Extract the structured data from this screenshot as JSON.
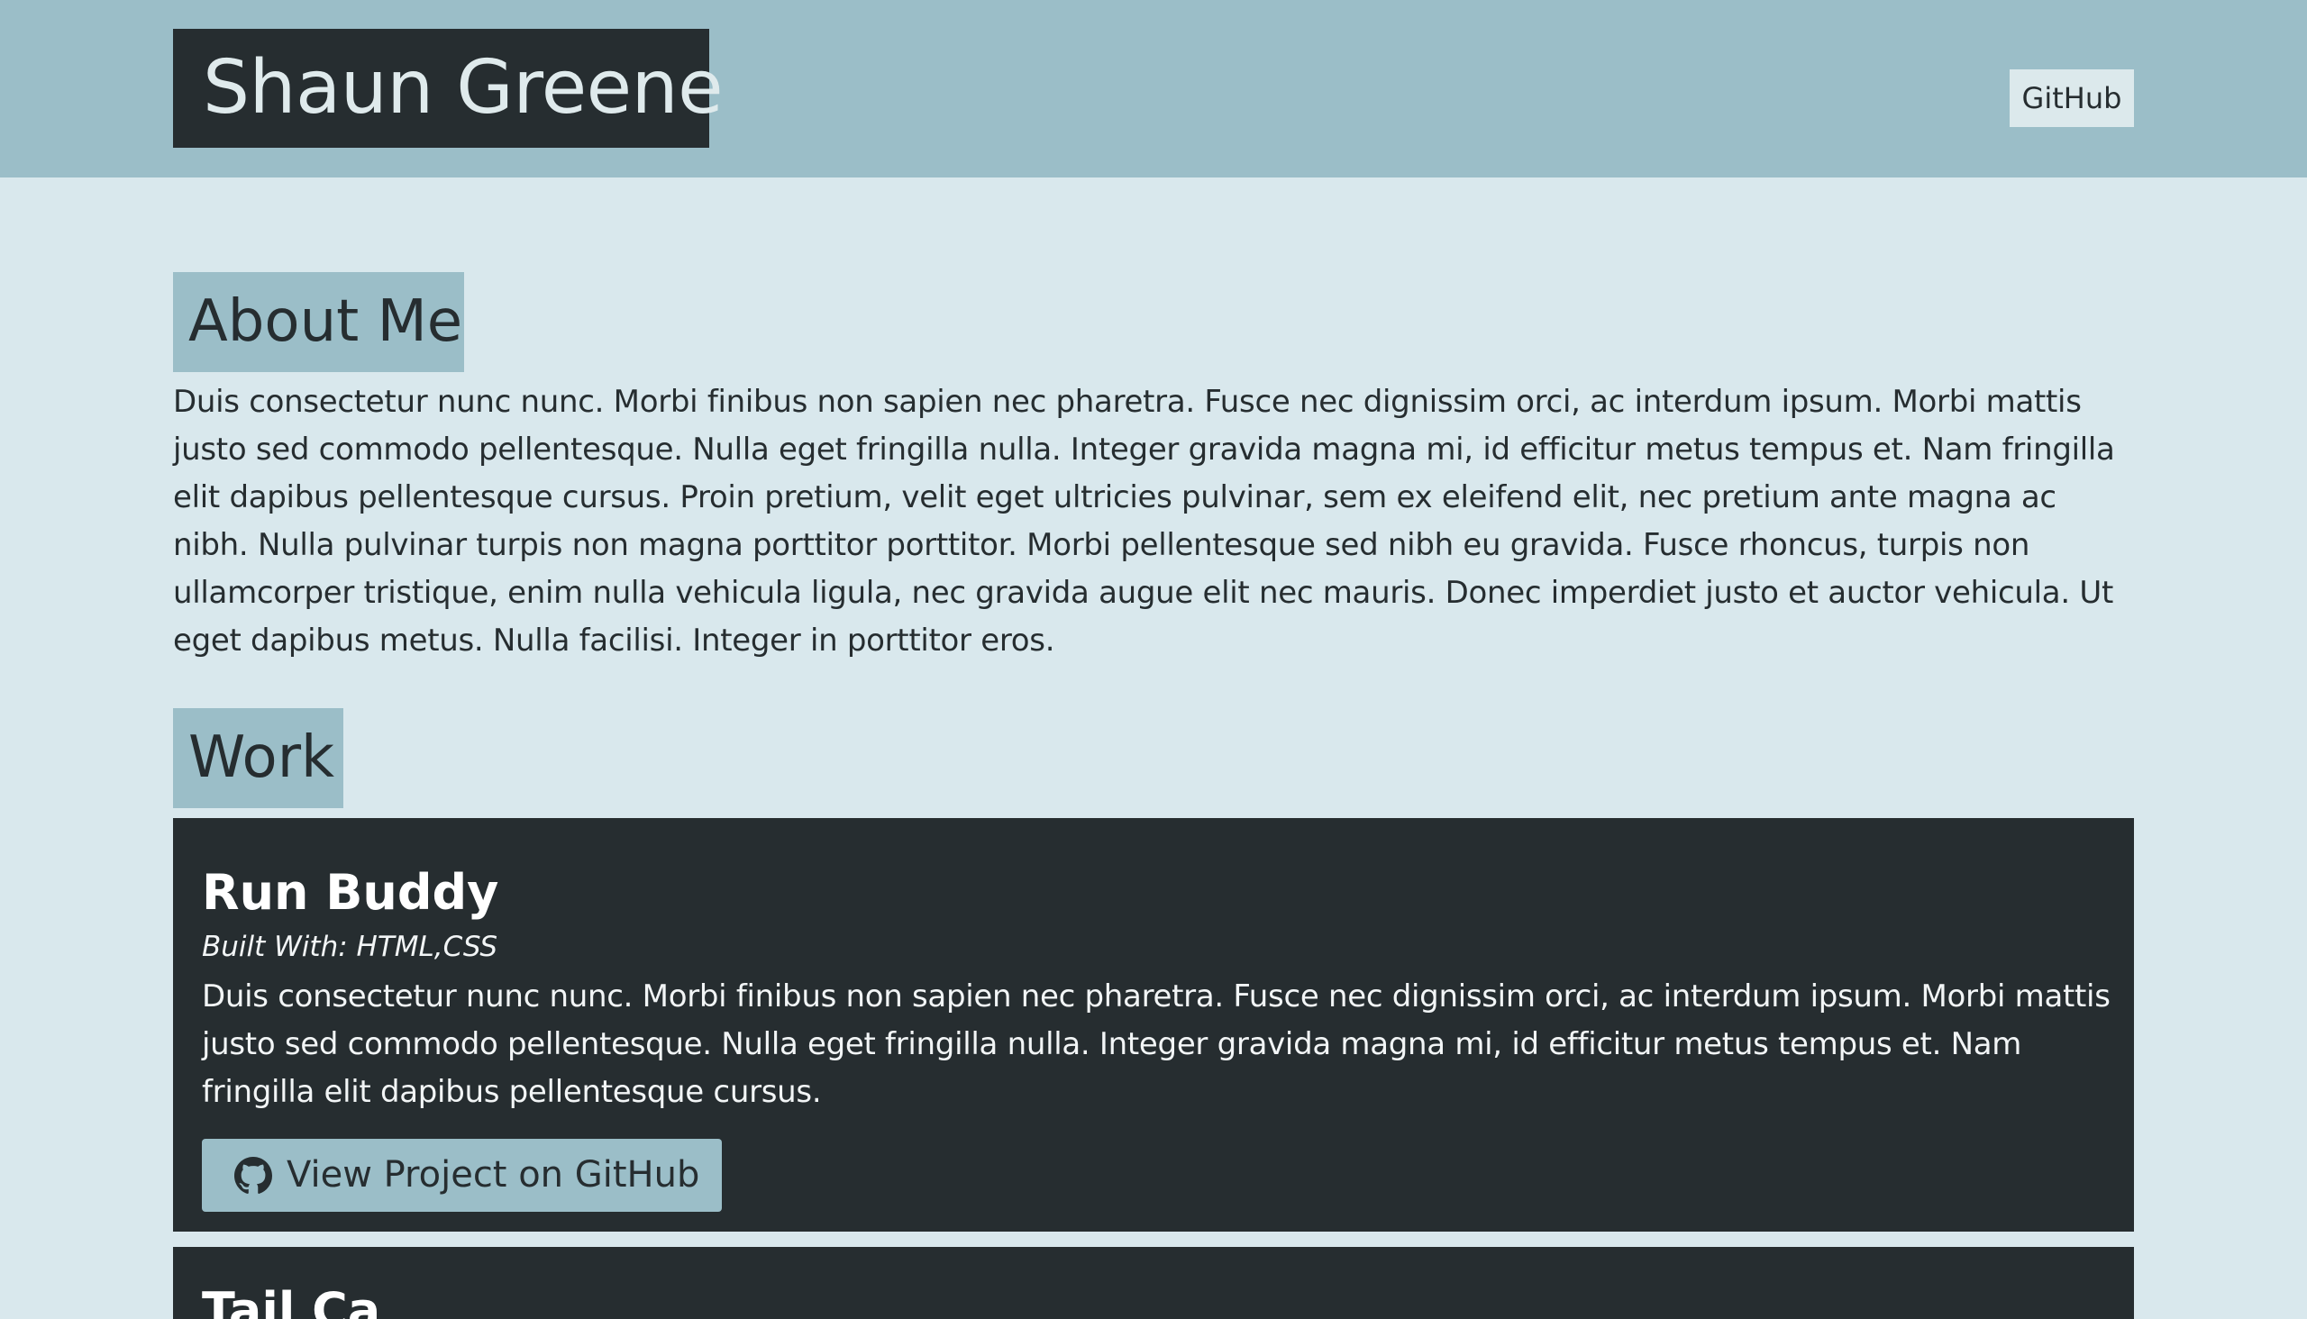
{
  "header": {
    "brand": "Shaun Greene",
    "nav_link": "GitHub"
  },
  "about": {
    "heading": "About Me",
    "text": "Duis consectetur nunc nunc. Morbi finibus non sapien nec pharetra. Fusce nec dignissim orci, ac interdum ipsum. Morbi mattis justo sed commodo pellentesque. Nulla eget fringilla nulla. Integer gravida magna mi, id efficitur metus tempus et. Nam fringilla elit dapibus pellentesque cursus. Proin pretium, velit eget ultricies pulvinar, sem ex eleifend elit, nec pretium ante magna ac nibh. Nulla pulvinar turpis non magna porttitor porttitor. Morbi pellentesque sed nibh eu gravida. Fusce rhoncus, turpis non ullamcorper tristique, enim nulla vehicula ligula, nec gravida augue elit nec mauris. Donec imperdiet justo et auctor vehicula. Ut eget dapibus metus. Nulla facilisi. Integer in porttitor eros."
  },
  "work": {
    "heading": "Work",
    "projects": [
      {
        "title": "Run Buddy",
        "built_with": "Built With: HTML,CSS",
        "description": "Duis consectetur nunc nunc. Morbi finibus non sapien nec pharetra. Fusce nec dignissim orci, ac interdum ipsum. Morbi mattis justo sed commodo pellentesque. Nulla eget fringilla nulla. Integer gravida magna mi, id efficitur metus tempus et. Nam fringilla elit dapibus pellentesque cursus.",
        "button_label": "View Project on GitHub",
        "button_icon": "github-icon"
      },
      {
        "title": "Tail Ca"
      }
    ]
  },
  "colors": {
    "header_bg": "#9bbec8",
    "page_bg": "#d9e8ed",
    "dark": "#262d30",
    "accent": "#9bbec8"
  }
}
